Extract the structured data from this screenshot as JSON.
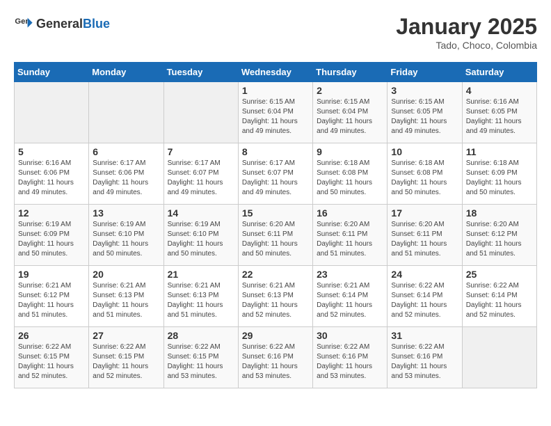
{
  "header": {
    "logo_general": "General",
    "logo_blue": "Blue",
    "month": "January 2025",
    "location": "Tado, Choco, Colombia"
  },
  "weekdays": [
    "Sunday",
    "Monday",
    "Tuesday",
    "Wednesday",
    "Thursday",
    "Friday",
    "Saturday"
  ],
  "weeks": [
    [
      {
        "day": "",
        "info": ""
      },
      {
        "day": "",
        "info": ""
      },
      {
        "day": "",
        "info": ""
      },
      {
        "day": "1",
        "info": "Sunrise: 6:15 AM\nSunset: 6:04 PM\nDaylight: 11 hours and 49 minutes."
      },
      {
        "day": "2",
        "info": "Sunrise: 6:15 AM\nSunset: 6:04 PM\nDaylight: 11 hours and 49 minutes."
      },
      {
        "day": "3",
        "info": "Sunrise: 6:15 AM\nSunset: 6:05 PM\nDaylight: 11 hours and 49 minutes."
      },
      {
        "day": "4",
        "info": "Sunrise: 6:16 AM\nSunset: 6:05 PM\nDaylight: 11 hours and 49 minutes."
      }
    ],
    [
      {
        "day": "5",
        "info": "Sunrise: 6:16 AM\nSunset: 6:06 PM\nDaylight: 11 hours and 49 minutes."
      },
      {
        "day": "6",
        "info": "Sunrise: 6:17 AM\nSunset: 6:06 PM\nDaylight: 11 hours and 49 minutes."
      },
      {
        "day": "7",
        "info": "Sunrise: 6:17 AM\nSunset: 6:07 PM\nDaylight: 11 hours and 49 minutes."
      },
      {
        "day": "8",
        "info": "Sunrise: 6:17 AM\nSunset: 6:07 PM\nDaylight: 11 hours and 49 minutes."
      },
      {
        "day": "9",
        "info": "Sunrise: 6:18 AM\nSunset: 6:08 PM\nDaylight: 11 hours and 50 minutes."
      },
      {
        "day": "10",
        "info": "Sunrise: 6:18 AM\nSunset: 6:08 PM\nDaylight: 11 hours and 50 minutes."
      },
      {
        "day": "11",
        "info": "Sunrise: 6:18 AM\nSunset: 6:09 PM\nDaylight: 11 hours and 50 minutes."
      }
    ],
    [
      {
        "day": "12",
        "info": "Sunrise: 6:19 AM\nSunset: 6:09 PM\nDaylight: 11 hours and 50 minutes."
      },
      {
        "day": "13",
        "info": "Sunrise: 6:19 AM\nSunset: 6:10 PM\nDaylight: 11 hours and 50 minutes."
      },
      {
        "day": "14",
        "info": "Sunrise: 6:19 AM\nSunset: 6:10 PM\nDaylight: 11 hours and 50 minutes."
      },
      {
        "day": "15",
        "info": "Sunrise: 6:20 AM\nSunset: 6:11 PM\nDaylight: 11 hours and 50 minutes."
      },
      {
        "day": "16",
        "info": "Sunrise: 6:20 AM\nSunset: 6:11 PM\nDaylight: 11 hours and 51 minutes."
      },
      {
        "day": "17",
        "info": "Sunrise: 6:20 AM\nSunset: 6:11 PM\nDaylight: 11 hours and 51 minutes."
      },
      {
        "day": "18",
        "info": "Sunrise: 6:20 AM\nSunset: 6:12 PM\nDaylight: 11 hours and 51 minutes."
      }
    ],
    [
      {
        "day": "19",
        "info": "Sunrise: 6:21 AM\nSunset: 6:12 PM\nDaylight: 11 hours and 51 minutes."
      },
      {
        "day": "20",
        "info": "Sunrise: 6:21 AM\nSunset: 6:13 PM\nDaylight: 11 hours and 51 minutes."
      },
      {
        "day": "21",
        "info": "Sunrise: 6:21 AM\nSunset: 6:13 PM\nDaylight: 11 hours and 51 minutes."
      },
      {
        "day": "22",
        "info": "Sunrise: 6:21 AM\nSunset: 6:13 PM\nDaylight: 11 hours and 52 minutes."
      },
      {
        "day": "23",
        "info": "Sunrise: 6:21 AM\nSunset: 6:14 PM\nDaylight: 11 hours and 52 minutes."
      },
      {
        "day": "24",
        "info": "Sunrise: 6:22 AM\nSunset: 6:14 PM\nDaylight: 11 hours and 52 minutes."
      },
      {
        "day": "25",
        "info": "Sunrise: 6:22 AM\nSunset: 6:14 PM\nDaylight: 11 hours and 52 minutes."
      }
    ],
    [
      {
        "day": "26",
        "info": "Sunrise: 6:22 AM\nSunset: 6:15 PM\nDaylight: 11 hours and 52 minutes."
      },
      {
        "day": "27",
        "info": "Sunrise: 6:22 AM\nSunset: 6:15 PM\nDaylight: 11 hours and 52 minutes."
      },
      {
        "day": "28",
        "info": "Sunrise: 6:22 AM\nSunset: 6:15 PM\nDaylight: 11 hours and 53 minutes."
      },
      {
        "day": "29",
        "info": "Sunrise: 6:22 AM\nSunset: 6:16 PM\nDaylight: 11 hours and 53 minutes."
      },
      {
        "day": "30",
        "info": "Sunrise: 6:22 AM\nSunset: 6:16 PM\nDaylight: 11 hours and 53 minutes."
      },
      {
        "day": "31",
        "info": "Sunrise: 6:22 AM\nSunset: 6:16 PM\nDaylight: 11 hours and 53 minutes."
      },
      {
        "day": "",
        "info": ""
      }
    ]
  ]
}
